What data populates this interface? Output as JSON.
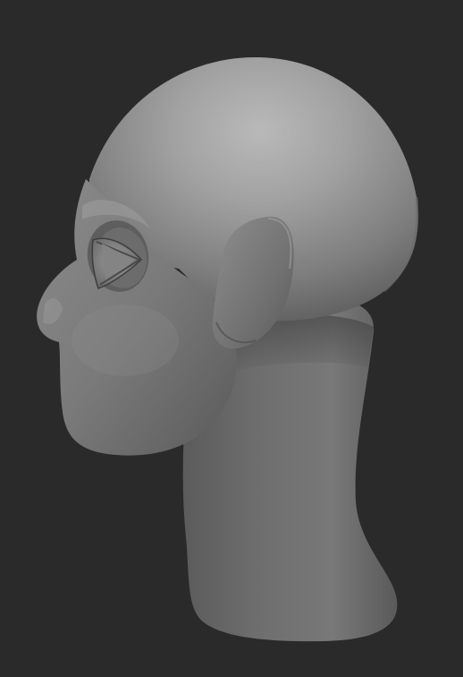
{
  "scene": {
    "background_color": "#2a2a2a",
    "subject": "sculpted-head-side-profile",
    "material_color": "#8c8c8c",
    "view": "left-side-profile"
  }
}
